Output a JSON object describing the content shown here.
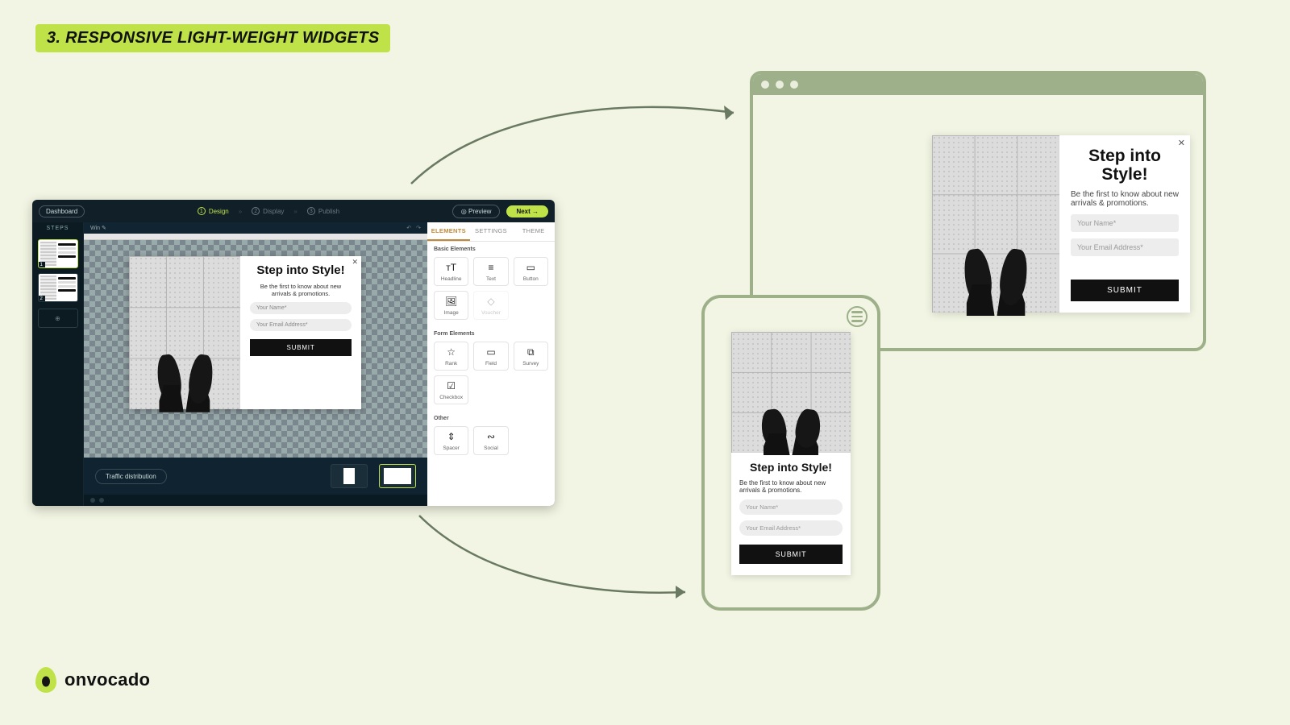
{
  "headline": "3. RESPONSIVE LIGHT-WEIGHT WIDGETS",
  "brand": "onvocado",
  "editor": {
    "dashboard": "Dashboard",
    "wizard": {
      "design": "Design",
      "display": "Display",
      "publish": "Publish"
    },
    "preview": "Preview",
    "next": "Next →",
    "canvas_title": "Win ✎",
    "steps_label": "STEPS",
    "step1_num": "1",
    "step2_num": "2",
    "add": "⊕",
    "traffic": "Traffic distribution",
    "panel": {
      "tabs": {
        "elements": "ELEMENTS",
        "settings": "SETTINGS",
        "theme": "THEME"
      },
      "basic": "Basic Elements",
      "form": "Form Elements",
      "other": "Other",
      "tiles": {
        "headline": "Headline",
        "text": "Text",
        "button": "Button",
        "image": "Image",
        "voucher": "Voucher",
        "rank": "Rank",
        "field": "Field",
        "survey": "Survey",
        "checkbox": "Checkbox",
        "spacer": "Spacer",
        "social": "Social"
      }
    }
  },
  "popup": {
    "title": "Step into Style!",
    "subtitle": "Be the first to know about new arrivals & promotions.",
    "name_placeholder": "Your Name*",
    "email_placeholder": "Your Email Address*",
    "submit": "SUBMIT"
  }
}
